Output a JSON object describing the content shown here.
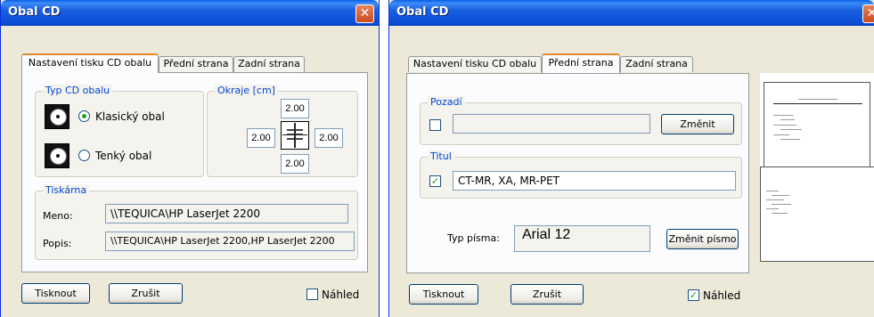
{
  "window1": {
    "title": "Obal CD",
    "close_glyph": "✕",
    "tabs": [
      "Nastavení tisku CD obalu",
      "Přední strana",
      "Zadní strana"
    ],
    "active_tab": 0,
    "typ_group": {
      "label": "Typ CD obalu",
      "options": [
        {
          "label": "Klasický obal",
          "selected": true,
          "icon": "cd-case-icon"
        },
        {
          "label": "Tenký obal",
          "selected": false,
          "icon": "cd-slim-case-icon"
        }
      ]
    },
    "okraje_group": {
      "label": "Okraje [cm]",
      "top": "2.00",
      "left": "2.00",
      "right": "2.00",
      "bottom": "2.00",
      "icon": "margins-icon"
    },
    "tiskarna_group": {
      "label": "Tiskárna",
      "meno_label": "Meno:",
      "meno_value": "\\\\TEQUICA\\HP LaserJet 2200",
      "popis_label": "Popis:",
      "popis_value": "\\\\TEQUICA\\HP LaserJet 2200,HP LaserJet 2200"
    },
    "print_button": "Tisknout",
    "cancel_button": "Zrušit",
    "preview_label": "Náhled",
    "preview_checked": false
  },
  "window2": {
    "title": "Obal CD",
    "tabs": [
      "Nastavení tisku CD obalu",
      "Přední strana",
      "Zadní strana"
    ],
    "active_tab": 1,
    "pozadi_group": {
      "label": "Pozadí",
      "checked": false,
      "path_value": "",
      "change_button": "Změnit"
    },
    "titul_group": {
      "label": "Titul",
      "checked": true,
      "value": "CT-MR, XA, MR-PET"
    },
    "font_label": "Typ písma:",
    "font_value": "Arial 12",
    "font_button": "Změnit písmo",
    "print_button": "Tisknout",
    "cancel_button": "Zrušit",
    "preview_label": "Náhled",
    "preview_checked": true,
    "check_glyph": "✓"
  }
}
